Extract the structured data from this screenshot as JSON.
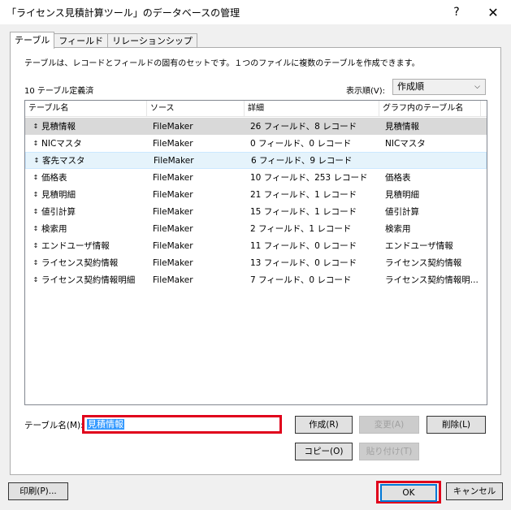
{
  "window": {
    "title": "「ライセンス見積計算ツール」のデータベースの管理",
    "help": "?",
    "close": "✕"
  },
  "tabs": [
    {
      "label": "テーブル"
    },
    {
      "label": "フィールド"
    },
    {
      "label": "リレーションシップ"
    }
  ],
  "panel": {
    "description": "テーブルは、レコードとフィールドの固有のセットです。１つのファイルに複数のテーブルを作成できます。",
    "count_text": "10 テーブル定義済",
    "sort_label": "表示順(V):",
    "sort_value": "作成順"
  },
  "table": {
    "columns": [
      "テーブル名",
      "ソース",
      "詳細",
      "グラフ内のテーブル名"
    ],
    "rows": [
      {
        "name": "見積情報",
        "source": "FileMaker",
        "detail": "26 フィールド、8 レコード",
        "graph": "見積情報"
      },
      {
        "name": "NICマスタ",
        "source": "FileMaker",
        "detail": "0 フィールド、0 レコード",
        "graph": "NICマスタ"
      },
      {
        "name": "客先マスタ",
        "source": "FileMaker",
        "detail": "6 フィールド、9 レコード",
        "graph": ""
      },
      {
        "name": "価格表",
        "source": "FileMaker",
        "detail": "10 フィールド、253 レコード",
        "graph": "価格表"
      },
      {
        "name": "見積明細",
        "source": "FileMaker",
        "detail": "21 フィールド、1 レコード",
        "graph": "見積明細"
      },
      {
        "name": "値引計算",
        "source": "FileMaker",
        "detail": "15 フィールド、1 レコード",
        "graph": "値引計算"
      },
      {
        "name": "検索用",
        "source": "FileMaker",
        "detail": "2 フィールド、1 レコード",
        "graph": "検索用"
      },
      {
        "name": "エンドユーザ情報",
        "source": "FileMaker",
        "detail": "11 フィールド、0 レコード",
        "graph": "エンドユーザ情報"
      },
      {
        "name": "ライセンス契約情報",
        "source": "FileMaker",
        "detail": "13 フィールド、0 レコード",
        "graph": "ライセンス契約情報"
      },
      {
        "name": "ライセンス契約情報明細",
        "source": "FileMaker",
        "detail": "7 フィールド、0 レコード",
        "graph": "ライセンス契約情報明..."
      }
    ]
  },
  "table_name": {
    "label": "テーブル名(M):",
    "value": "見積情報"
  },
  "buttons": {
    "create": "作成(R)",
    "change": "変更(A)",
    "delete": "削除(L)",
    "copy": "コピー(O)",
    "paste": "貼り付け(T)",
    "print": "印刷(P)...",
    "ok": "OK",
    "cancel": "キャンセル"
  },
  "colors": {
    "highlight_red": "#e0001b",
    "selection_blue": "#3399ff"
  }
}
